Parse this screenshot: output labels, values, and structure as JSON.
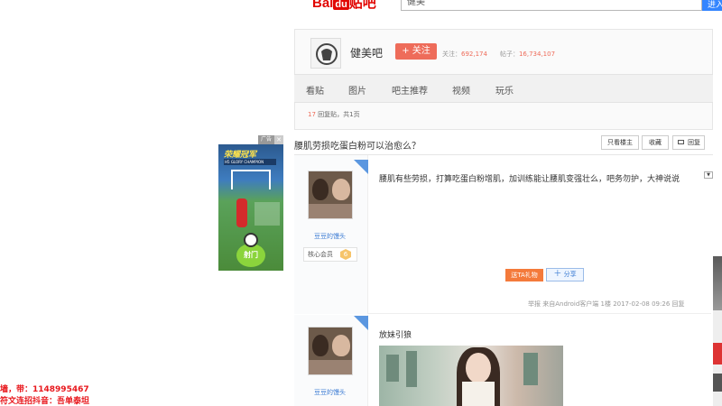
{
  "search": {
    "logo_text_a": "Bai",
    "logo_text_du": "du",
    "logo_text_b": "贴吧",
    "query": "健美",
    "button": "进入"
  },
  "forum": {
    "name": "健美吧",
    "follow_label": "+ 关注",
    "followers_label": "关注：",
    "followers_value": "692,174",
    "posts_label": "帖子：",
    "posts_value": "16,734,107",
    "nav": [
      "看贴",
      "图片",
      "吧主推荐",
      "视频",
      "玩乐"
    ],
    "reply_count_num": "17",
    "reply_count_text": "回复贴，共1页"
  },
  "thread": {
    "title": "腰肌劳损吃蛋白粉可以治愈么？",
    "buttons": [
      "只看楼主",
      "收藏",
      "回复"
    ]
  },
  "posts": [
    {
      "author": "豆豆的馒头",
      "member": "核心会员",
      "level": "6",
      "text": "腰肌有些劳损，打算吃蛋白粉增肌，加训练能让腰肌变强壮么，吧务勿护，大神说说",
      "gift": "送TA礼物",
      "share": "分享",
      "meta": "举报  来自Android客户端  1楼  2017-02-08 09:26  回复"
    },
    {
      "author": "豆豆的馒头",
      "text": "放妹引狼"
    }
  ],
  "ad": {
    "tag": "广告",
    "close": "✕",
    "title": "荣耀冠军",
    "subtitle": "H5 GLORY CHAMPION",
    "kick": "射门"
  },
  "overlay": {
    "line1": "墙，带：1148995467",
    "line2": "符文连招抖音：吾单泰坦"
  }
}
